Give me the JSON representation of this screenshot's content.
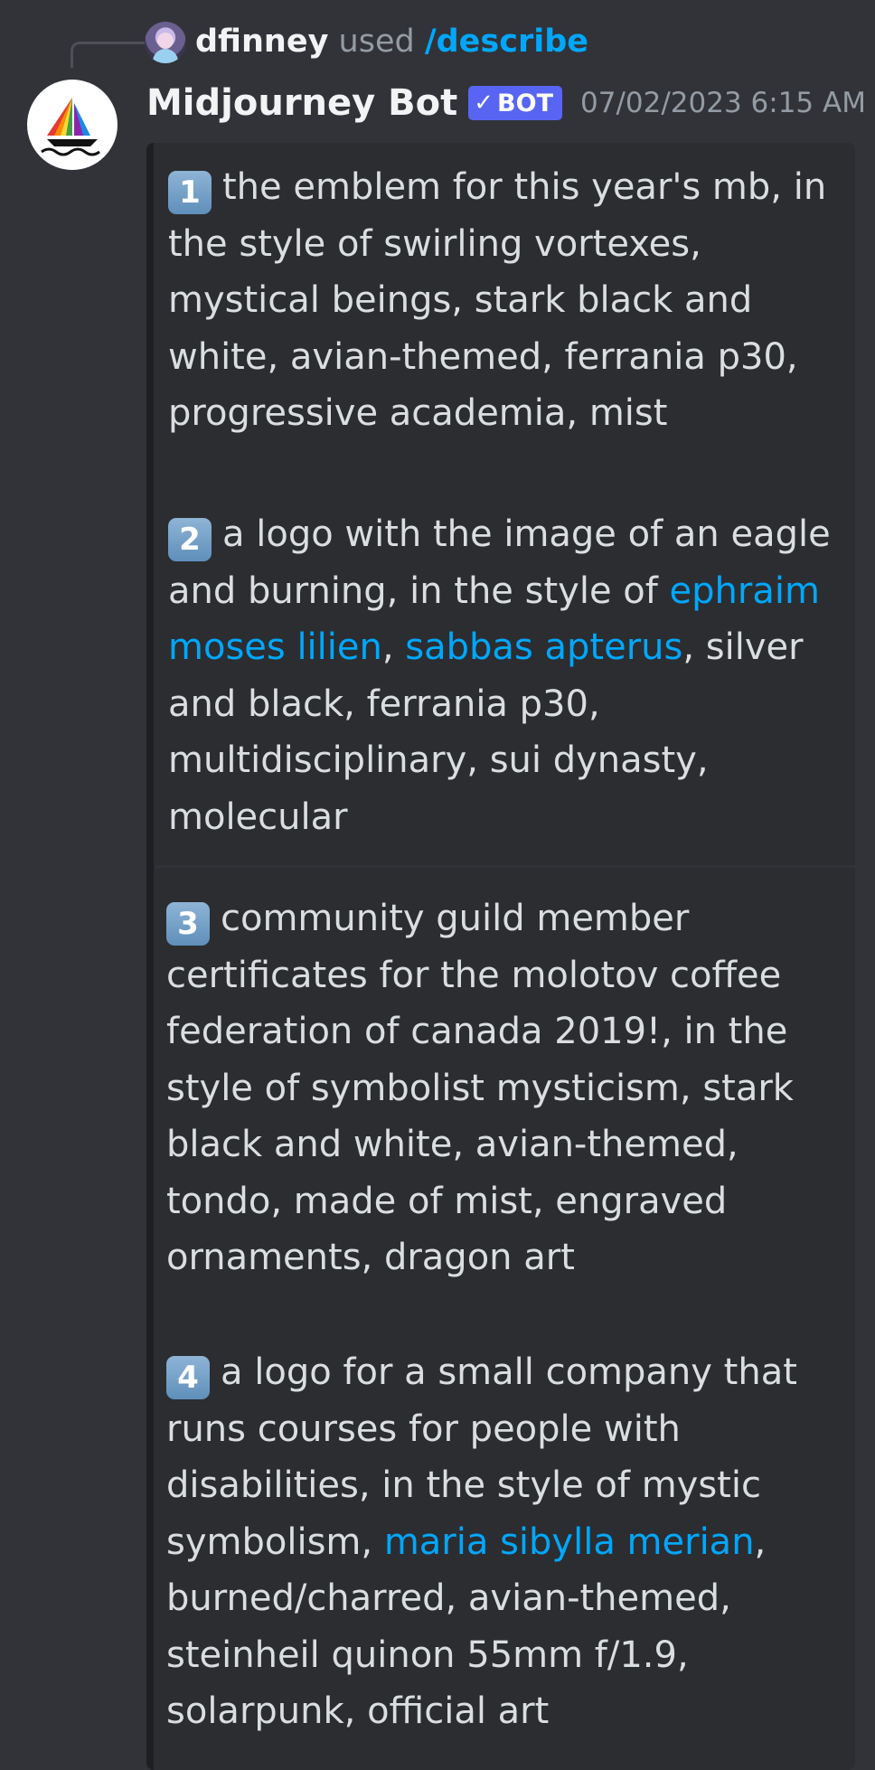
{
  "reply": {
    "user": "dfinney",
    "used": "used",
    "command": "/describe"
  },
  "author": {
    "name": "Midjourney Bot",
    "badge": "BOT",
    "timestamp": "07/02/2023 6:15 AM"
  },
  "prompts": [
    {
      "number": "1",
      "text_1": "the emblem for this year's mb, in the style of swirling vortexes, mystical beings, stark black and white, avian-themed, ferrania p30, progressive academia, mist"
    },
    {
      "number": "2",
      "text_1": "a logo with the image of an eagle and burning, in the style of ",
      "link_1": "ephraim moses lilien",
      "sep_1": ", ",
      "link_2": "sabbas apterus",
      "text_2": ", silver and black, ferrania p30, multidisciplinary, sui dynasty, molecular"
    },
    {
      "number": "3",
      "text_1": "community guild member certificates for the molotov coffee federation of canada 2019!, in the style of symbolist mysticism, stark black and white, avian-themed, tondo, made of mist, engraved ornaments, dragon art"
    },
    {
      "number": "4",
      "text_1": "a logo for a small company that runs courses for people with disabilities, in the style of mystic symbolism, ",
      "link_1": "maria sibylla merian",
      "text_2": ", burned/charred, avian-themed, steinheil quinon 55mm f/1.9, solarpunk, official art"
    }
  ],
  "colors": {
    "background": "#313338",
    "embed": "#2b2d31",
    "link": "#00a8fc",
    "badge": "#5865f2"
  },
  "icons": {
    "bot_avatar": "sailboat-logo-icon",
    "badge_check": "check-icon",
    "number_emoji": "keycap-digit-icon"
  }
}
